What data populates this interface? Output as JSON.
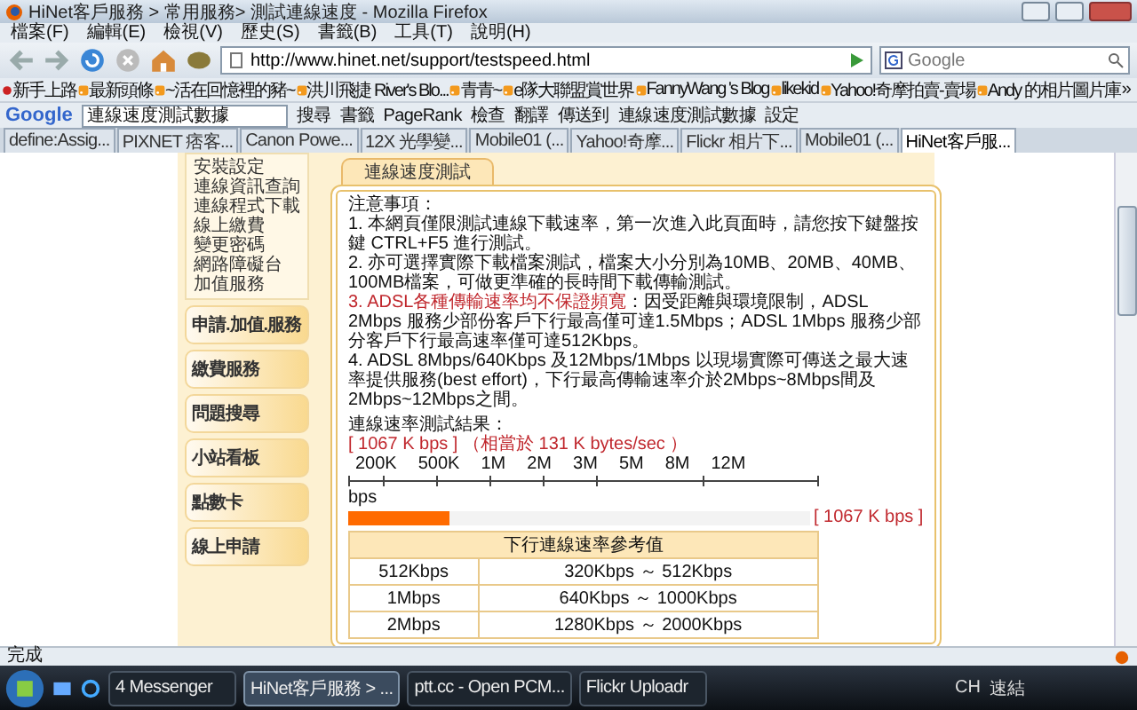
{
  "window": {
    "title": "HiNet客戶服務 > 常用服務> 測試連線速度 - Mozilla Firefox"
  },
  "menu": [
    "檔案(F)",
    "編輯(E)",
    "檢視(V)",
    "歷史(S)",
    "書籤(B)",
    "工具(T)",
    "說明(H)"
  ],
  "address": {
    "value": "http://www.hinet.net/support/testspeed.html"
  },
  "search": {
    "placeholder": "Google"
  },
  "bookmarks": [
    "新手上路",
    "最新頭條",
    "~活在回憶裡的豬~",
    "洪川飛捷 River's Blo...",
    "青青~",
    "e隊大聯盟賞世界",
    "FannyWang 's Blog",
    "likekid",
    "Yahoo!奇摩拍賣-賣場",
    "Andy 的相片圖片庫"
  ],
  "bookmarks_more": "»",
  "google_toolbar": {
    "logo": "Google",
    "query": "連線速度測試數據",
    "buttons": [
      "搜尋",
      "書籤",
      "PageRank",
      "檢查",
      "翻譯",
      "傳送到",
      "連線速度測試數據",
      "設定"
    ]
  },
  "tabs": [
    {
      "label": "define:Assig...",
      "selected": false
    },
    {
      "label": "PIXNET 痞客...",
      "selected": false
    },
    {
      "label": "Canon Powe...",
      "selected": false
    },
    {
      "label": "12X 光學變...",
      "selected": false
    },
    {
      "label": "Mobile01 (...",
      "selected": false
    },
    {
      "label": "Yahoo!奇摩...",
      "selected": false
    },
    {
      "label": "Flickr 相片下...",
      "selected": false
    },
    {
      "label": "Mobile01 (...",
      "selected": false
    },
    {
      "label": "HiNet客戶服...",
      "selected": true
    }
  ],
  "sidebar": {
    "links": [
      "安裝設定",
      "連線資訊查詢",
      "連線程式下載",
      "線上繳費",
      "變更密碼",
      "網路障礙台",
      "加值服務"
    ],
    "buttons": [
      "申請.加值.服務",
      "繳費服務",
      "問題搜尋",
      "小站看板",
      "點數卡",
      "線上申請"
    ]
  },
  "panel": {
    "title": "連線速度測試",
    "heading": "注意事項：",
    "notes": [
      {
        "text": "1. 本網頁僅限測試連線下載速率，第一次進入此頁面時，請您按下鍵盤按鍵 CTRL+F5 進行測試。"
      },
      {
        "text": "2. 亦可選擇實際下載檔案測試，檔案大小分別為10MB、20MB、40MB、100MB檔案，可做更準確的長時間下載傳輸測試。"
      },
      {
        "highlight": "3. ADSL各種傳輸速率均不保證頻寬",
        "text": "：因受距離與環境限制，ADSL 2Mbps 服務少部份客戶下行最高僅可達1.5Mbps；ADSL 1Mbps 服務少部分客戶下行最高速率僅可達512Kbps。"
      },
      {
        "text": "4. ADSL 8Mbps/640Kbps 及12Mbps/1Mbps 以現場實際可傳送之最大速率提供服務(best effort)，下行最高傳輸速率介於2Mbps~8Mbps間及2Mbps~12Mbps之間。"
      }
    ],
    "result_label": "連線速率測試結果：",
    "result_value": "[ 1067 K bps ]",
    "result_bytes": "（相當於 131 K bytes/sec ）",
    "scale_ticks": [
      "200K",
      "500K",
      "1M",
      "2M",
      "3M",
      "5M",
      "8M",
      "12M"
    ],
    "scale_unit": "bps",
    "meter": {
      "level": 0.22,
      "reading": "[ 1067 K bps ]"
    },
    "table": {
      "title": "下行連線速率參考值",
      "rows": [
        [
          "512Kbps",
          "320Kbps ～ 512Kbps"
        ],
        [
          "1Mbps",
          "640Kbps ～ 1000Kbps"
        ],
        [
          "2Mbps",
          "1280Kbps ～ 2000Kbps"
        ]
      ]
    }
  },
  "status_bar": "完成",
  "taskbar": {
    "tasks": [
      {
        "label": "4 Messenger",
        "selected": false
      },
      {
        "label": "HiNet客戶服務 > ...",
        "selected": true
      },
      {
        "label": "ptt.cc - Open PCM...",
        "selected": false
      },
      {
        "label": "Flickr Uploadr",
        "selected": false
      }
    ],
    "tray": [
      "CH",
      "速結"
    ]
  }
}
